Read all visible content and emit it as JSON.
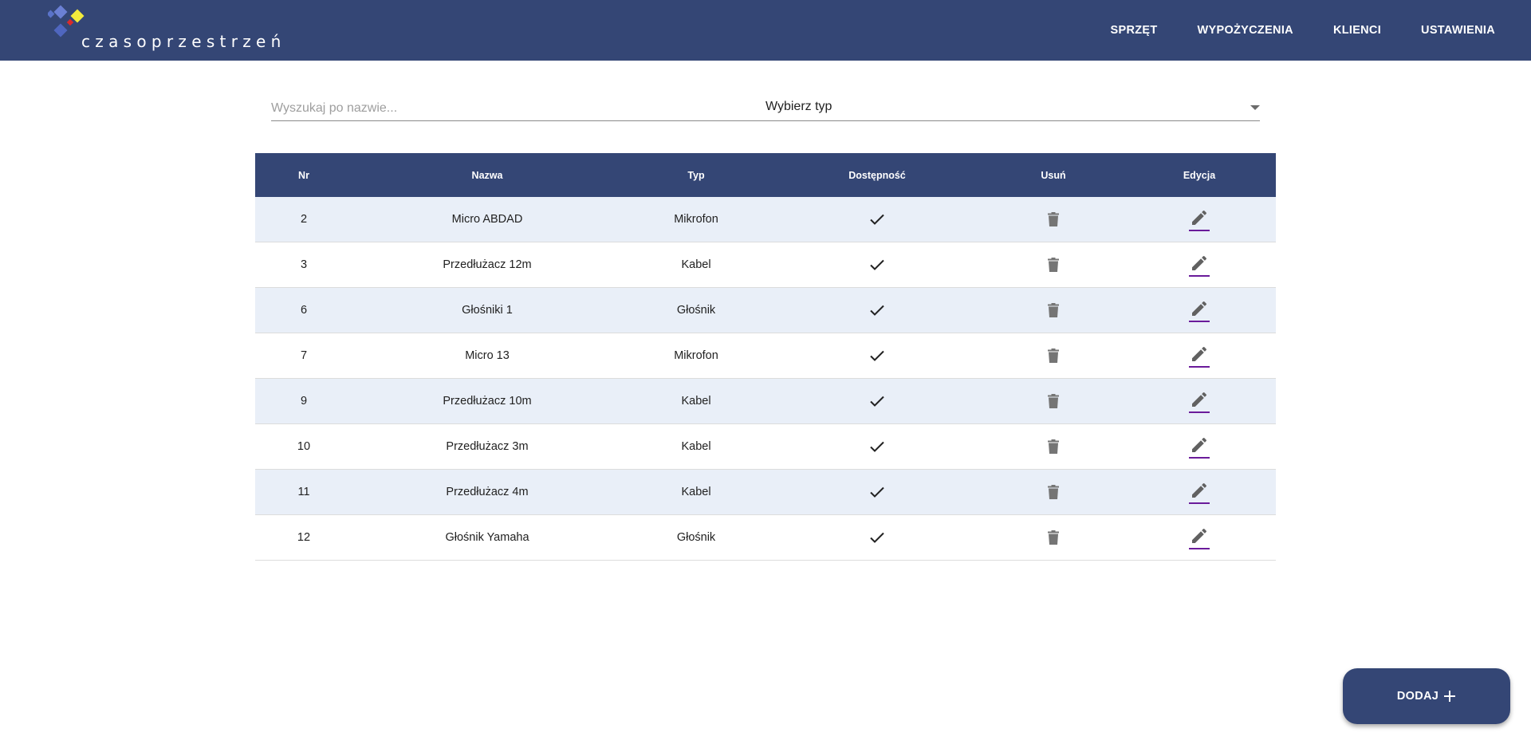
{
  "app": {
    "brand": "czasoprzestrzeń",
    "accent": "#344675",
    "row_alt_color": "#e9eff8",
    "edit_underline_color": "#6a1b9a"
  },
  "nav": {
    "items": [
      {
        "label": "SPRZĘT"
      },
      {
        "label": "WYPOŻYCZENIA"
      },
      {
        "label": "KLIENCI"
      },
      {
        "label": "USTAWIENIA"
      }
    ]
  },
  "filters": {
    "search_placeholder": "Wyszukaj po nazwie...",
    "search_value": "",
    "type_select_label": "Wybierz typ",
    "type_select_icon": "dropdown-arrow-icon"
  },
  "table": {
    "headers": {
      "nr": "Nr",
      "name": "Nazwa",
      "type": "Typ",
      "availability": "Dostępność",
      "delete": "Usuń",
      "edit": "Edycja"
    },
    "rows": [
      {
        "nr": "2",
        "name": "Micro ABDAD",
        "type": "Mikrofon",
        "available": true
      },
      {
        "nr": "3",
        "name": "Przedłużacz 12m",
        "type": "Kabel",
        "available": true
      },
      {
        "nr": "6",
        "name": "Głośniki 1",
        "type": "Głośnik",
        "available": true
      },
      {
        "nr": "7",
        "name": "Micro 13",
        "type": "Mikrofon",
        "available": true
      },
      {
        "nr": "9",
        "name": "Przedłużacz 10m",
        "type": "Kabel",
        "available": true
      },
      {
        "nr": "10",
        "name": "Przedłużacz 3m",
        "type": "Kabel",
        "available": true
      },
      {
        "nr": "11",
        "name": "Przedłużacz 4m",
        "type": "Kabel",
        "available": true
      },
      {
        "nr": "12",
        "name": "Głośnik Yamaha",
        "type": "Głośnik",
        "available": true
      }
    ],
    "icons": {
      "available": "check-icon",
      "delete": "trash-icon",
      "edit": "pencil-icon"
    }
  },
  "fab": {
    "label": "DODAJ",
    "icon": "plus-icon"
  }
}
